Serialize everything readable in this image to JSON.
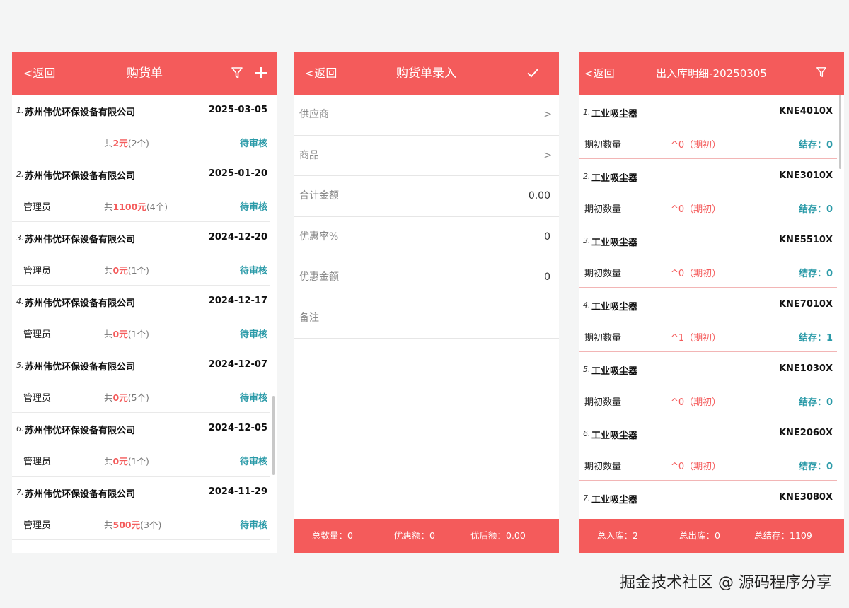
{
  "panel1": {
    "back": "<返回",
    "title": "购货单",
    "items": [
      {
        "num": "1.",
        "supplier": "苏州伟优环保设备有限公司",
        "date": "2025-03-05",
        "operator": "",
        "sum_prefix": "共",
        "amount": "2元",
        "count": "(2个)",
        "status": "待审核"
      },
      {
        "num": "2.",
        "supplier": "苏州伟优环保设备有限公司",
        "date": "2025-01-20",
        "operator": "管理员",
        "sum_prefix": "共",
        "amount": "1100元",
        "count": "(4个)",
        "status": "待审核"
      },
      {
        "num": "3.",
        "supplier": "苏州伟优环保设备有限公司",
        "date": "2024-12-20",
        "operator": "管理员",
        "sum_prefix": "共",
        "amount": "0元",
        "count": "(1个)",
        "status": "待审核"
      },
      {
        "num": "4.",
        "supplier": "苏州伟优环保设备有限公司",
        "date": "2024-12-17",
        "operator": "管理员",
        "sum_prefix": "共",
        "amount": "0元",
        "count": "(1个)",
        "status": "待审核"
      },
      {
        "num": "5.",
        "supplier": "苏州伟优环保设备有限公司",
        "date": "2024-12-07",
        "operator": "管理员",
        "sum_prefix": "共",
        "amount": "0元",
        "count": "(5个)",
        "status": "待审核"
      },
      {
        "num": "6.",
        "supplier": "苏州伟优环保设备有限公司",
        "date": "2024-12-05",
        "operator": "管理员",
        "sum_prefix": "共",
        "amount": "0元",
        "count": "(1个)",
        "status": "待审核"
      },
      {
        "num": "7.",
        "supplier": "苏州伟优环保设备有限公司",
        "date": "2024-11-29",
        "operator": "管理员",
        "sum_prefix": "共",
        "amount": "500元",
        "count": "(3个)",
        "status": "待审核"
      }
    ]
  },
  "panel2": {
    "back": "<返回",
    "title": "购货单录入",
    "fields": [
      {
        "label": "供应商",
        "value": "",
        "chevron": ">"
      },
      {
        "label": "商品",
        "value": "",
        "chevron": ">"
      },
      {
        "label": "合计金额",
        "value": "0.00",
        "chevron": ""
      },
      {
        "label": "优惠率%",
        "value": "0",
        "chevron": ""
      },
      {
        "label": "优惠金额",
        "value": "0",
        "chevron": ""
      },
      {
        "label": "备注",
        "value": "",
        "chevron": ""
      }
    ],
    "footer": {
      "total_qty": "总数量：0",
      "discount": "优惠额：0",
      "after": "优后额：0.00"
    }
  },
  "panel3": {
    "back": "<返回",
    "title": "出入库明细-20250305",
    "items": [
      {
        "num": "1.",
        "name": "工业吸尘器",
        "code": "KNE4010X",
        "label": "期初数量",
        "initial": "^0（期初）",
        "stock": "结存：0"
      },
      {
        "num": "2.",
        "name": "工业吸尘器",
        "code": "KNE3010X",
        "label": "期初数量",
        "initial": "^0（期初）",
        "stock": "结存：0"
      },
      {
        "num": "3.",
        "name": "工业吸尘器",
        "code": "KNE5510X",
        "label": "期初数量",
        "initial": "^0（期初）",
        "stock": "结存：0"
      },
      {
        "num": "4.",
        "name": "工业吸尘器",
        "code": "KNE7010X",
        "label": "期初数量",
        "initial": "^1（期初）",
        "stock": "结存：1"
      },
      {
        "num": "5.",
        "name": "工业吸尘器",
        "code": "KNE1030X",
        "label": "期初数量",
        "initial": "^0（期初）",
        "stock": "结存：0"
      },
      {
        "num": "6.",
        "name": "工业吸尘器",
        "code": "KNE2060X",
        "label": "期初数量",
        "initial": "^0（期初）",
        "stock": "结存：0"
      },
      {
        "num": "7.",
        "name": "工业吸尘器",
        "code": "KNE3080X",
        "label": "",
        "initial": "",
        "stock": ""
      }
    ],
    "footer": {
      "in": "总入库：2",
      "out": "总出库：0",
      "stock": "总结存：1109"
    }
  },
  "watermark": "掘金技术社区 @ 源码程序分享",
  "colors": {
    "accent": "#f45b5b",
    "status": "#2a9aa8"
  },
  "icons": [
    "filter-icon",
    "plus-icon",
    "check-icon"
  ]
}
